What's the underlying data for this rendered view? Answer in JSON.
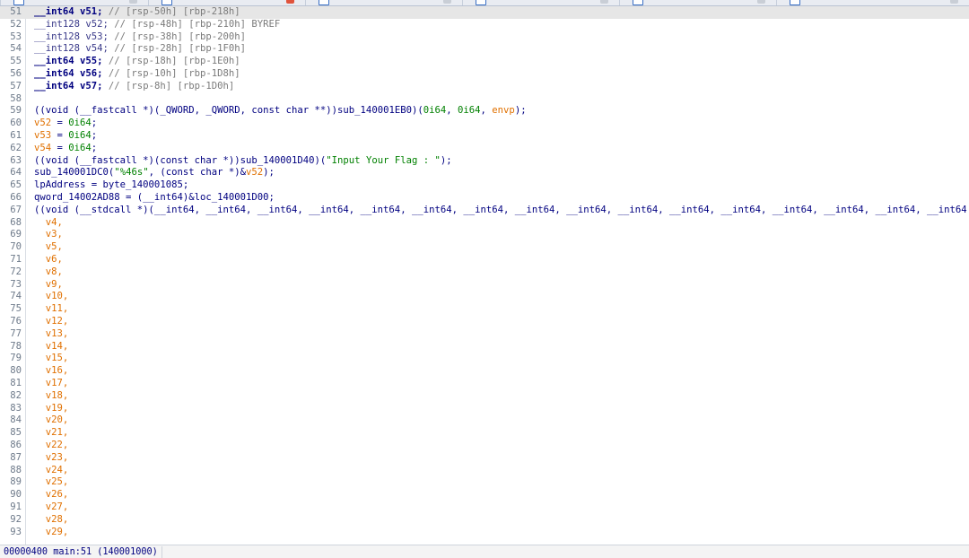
{
  "tabs": [
    {
      "active": false
    },
    {
      "active": true
    },
    {
      "active": false
    },
    {
      "active": false
    },
    {
      "active": false
    },
    {
      "active": false
    }
  ],
  "code_lines": [
    {
      "n": "51",
      "highlight": true,
      "segments": [
        [
          "vb",
          "__int64 v51; "
        ],
        [
          "c",
          "// [rsp-50h] [rbp-218h]"
        ]
      ]
    },
    {
      "n": "52",
      "segments": [
        [
          "typ",
          "__int128 v52; "
        ],
        [
          "c",
          "// [rsp-48h] [rbp-210h] BYREF"
        ]
      ]
    },
    {
      "n": "53",
      "segments": [
        [
          "typ",
          "__int128 v53; "
        ],
        [
          "c",
          "// [rsp-38h] [rbp-200h]"
        ]
      ]
    },
    {
      "n": "54",
      "segments": [
        [
          "typ",
          "__int128 v54; "
        ],
        [
          "c",
          "// [rsp-28h] [rbp-1F0h]"
        ]
      ]
    },
    {
      "n": "55",
      "segments": [
        [
          "vb",
          "__int64 v55; "
        ],
        [
          "c",
          "// [rsp-18h] [rbp-1E0h]"
        ]
      ]
    },
    {
      "n": "56",
      "segments": [
        [
          "vb",
          "__int64 v56; "
        ],
        [
          "c",
          "// [rsp-10h] [rbp-1D8h]"
        ]
      ]
    },
    {
      "n": "57",
      "segments": [
        [
          "vb",
          "__int64 v57; "
        ],
        [
          "c",
          "// [rsp-8h] [rbp-1D0h]"
        ]
      ]
    },
    {
      "n": "58",
      "segments": []
    },
    {
      "n": "59",
      "segments": [
        [
          "k",
          "((void (__fastcall *)(_QWORD, _QWORD, const char **))"
        ],
        [
          "f",
          "sub_140001EB0"
        ],
        [
          "k",
          ")("
        ],
        [
          "n",
          "0i64"
        ],
        [
          "k",
          ", "
        ],
        [
          "n",
          "0i64"
        ],
        [
          "k",
          ", "
        ],
        [
          "loc",
          "envp"
        ],
        [
          "k",
          ");"
        ]
      ]
    },
    {
      "n": "60",
      "segments": [
        [
          "loc",
          "v52"
        ],
        [
          "k",
          " = "
        ],
        [
          "n",
          "0i64"
        ],
        [
          "k",
          ";"
        ]
      ]
    },
    {
      "n": "61",
      "segments": [
        [
          "loc",
          "v53"
        ],
        [
          "k",
          " = "
        ],
        [
          "n",
          "0i64"
        ],
        [
          "k",
          ";"
        ]
      ]
    },
    {
      "n": "62",
      "segments": [
        [
          "loc",
          "v54"
        ],
        [
          "k",
          " = "
        ],
        [
          "n",
          "0i64"
        ],
        [
          "k",
          ";"
        ]
      ]
    },
    {
      "n": "63",
      "segments": [
        [
          "k",
          "((void (__fastcall *)(const char *))"
        ],
        [
          "f",
          "sub_140001D40"
        ],
        [
          "k",
          ")("
        ],
        [
          "s",
          "\"Input Your Flag : \""
        ],
        [
          "k",
          ");"
        ]
      ]
    },
    {
      "n": "64",
      "segments": [
        [
          "f",
          "sub_140001DC0"
        ],
        [
          "k",
          "("
        ],
        [
          "s",
          "\"%46s\""
        ],
        [
          "k",
          ", (const char *)&"
        ],
        [
          "loc",
          "v52"
        ],
        [
          "k",
          ");"
        ]
      ]
    },
    {
      "n": "65",
      "segments": [
        [
          "f",
          "lpAddress = byte_140001085;"
        ]
      ]
    },
    {
      "n": "66",
      "segments": [
        [
          "f",
          "qword_14002AD88 = (__int64)&loc_140001D00;"
        ]
      ]
    },
    {
      "n": "67",
      "segments": [
        [
          "k",
          "((void (__stdcall *)(__int64, __int64, __int64, __int64, __int64, __int64, __int64, __int64, __int64, __int64, __int64, __int64, __int64, __int64, __int64, __int64"
        ]
      ]
    },
    {
      "n": "68",
      "segments": [
        [
          "loc",
          "  v4,"
        ]
      ]
    },
    {
      "n": "69",
      "segments": [
        [
          "loc",
          "  v3,"
        ]
      ]
    },
    {
      "n": "70",
      "segments": [
        [
          "loc",
          "  v5,"
        ]
      ]
    },
    {
      "n": "71",
      "segments": [
        [
          "loc",
          "  v6,"
        ]
      ]
    },
    {
      "n": "72",
      "segments": [
        [
          "loc",
          "  v8,"
        ]
      ]
    },
    {
      "n": "73",
      "segments": [
        [
          "loc",
          "  v9,"
        ]
      ]
    },
    {
      "n": "74",
      "segments": [
        [
          "loc",
          "  v10,"
        ]
      ]
    },
    {
      "n": "75",
      "segments": [
        [
          "loc",
          "  v11,"
        ]
      ]
    },
    {
      "n": "76",
      "segments": [
        [
          "loc",
          "  v12,"
        ]
      ]
    },
    {
      "n": "77",
      "segments": [
        [
          "loc",
          "  v13,"
        ]
      ]
    },
    {
      "n": "78",
      "segments": [
        [
          "loc",
          "  v14,"
        ]
      ]
    },
    {
      "n": "79",
      "segments": [
        [
          "loc",
          "  v15,"
        ]
      ]
    },
    {
      "n": "80",
      "segments": [
        [
          "loc",
          "  v16,"
        ]
      ]
    },
    {
      "n": "81",
      "segments": [
        [
          "loc",
          "  v17,"
        ]
      ]
    },
    {
      "n": "82",
      "segments": [
        [
          "loc",
          "  v18,"
        ]
      ]
    },
    {
      "n": "83",
      "segments": [
        [
          "loc",
          "  v19,"
        ]
      ]
    },
    {
      "n": "84",
      "segments": [
        [
          "loc",
          "  v20,"
        ]
      ]
    },
    {
      "n": "85",
      "segments": [
        [
          "loc",
          "  v21,"
        ]
      ]
    },
    {
      "n": "86",
      "segments": [
        [
          "loc",
          "  v22,"
        ]
      ]
    },
    {
      "n": "87",
      "segments": [
        [
          "loc",
          "  v23,"
        ]
      ]
    },
    {
      "n": "88",
      "segments": [
        [
          "loc",
          "  v24,"
        ]
      ]
    },
    {
      "n": "89",
      "segments": [
        [
          "loc",
          "  v25,"
        ]
      ]
    },
    {
      "n": "90",
      "segments": [
        [
          "loc",
          "  v26,"
        ]
      ]
    },
    {
      "n": "91",
      "segments": [
        [
          "loc",
          "  v27,"
        ]
      ]
    },
    {
      "n": "92",
      "segments": [
        [
          "loc",
          "  v28,"
        ]
      ]
    },
    {
      "n": "93",
      "segments": [
        [
          "loc",
          "  v29,"
        ]
      ]
    }
  ],
  "status_bar": {
    "position": "00000400 main:51 (140001000)"
  },
  "colors": {
    "keyword": "#000080",
    "comment": "#7a7a7a",
    "string": "#008000",
    "local_var": "#e07000",
    "highlight_line": "#e6e6e6"
  }
}
